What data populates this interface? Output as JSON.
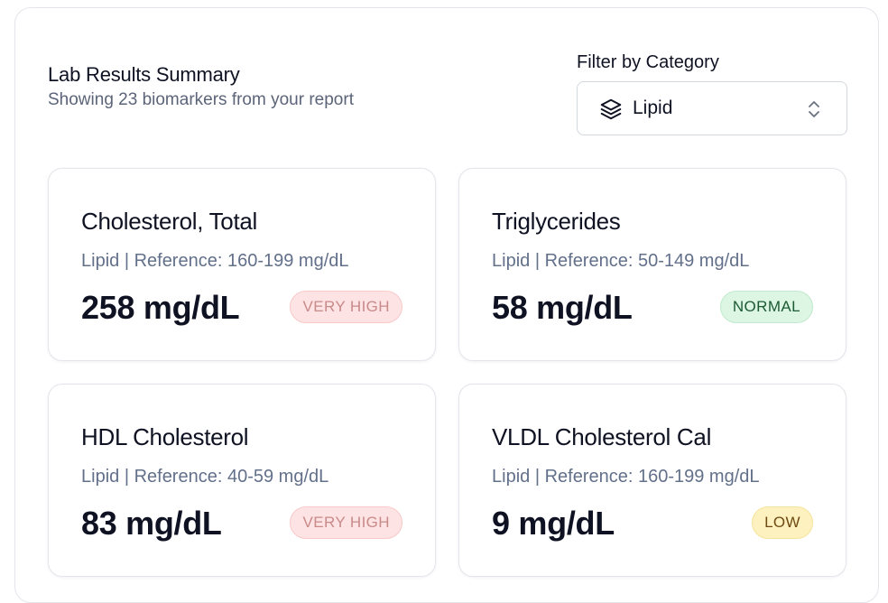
{
  "header": {
    "title": "Lab Results Summary",
    "subtitle": "Showing 23 biomarkers from your report"
  },
  "filter": {
    "label": "Filter by Category",
    "selected": "Lipid",
    "icon": "layers-icon",
    "chevron_icon": "chevron-up-down-icon"
  },
  "cards": [
    {
      "name": "Cholesterol, Total",
      "reference": "Lipid | Reference: 160-199 mg/dL",
      "value": "258 mg/dL",
      "status": "VERY HIGH",
      "status_colors": {
        "bg": "#fde3e3",
        "border": "#f8c9c9",
        "text": "#c98a8a"
      }
    },
    {
      "name": "Triglycerides",
      "reference": "Lipid | Reference: 50-149 mg/dL",
      "value": "58 mg/dL",
      "status": "NORMAL",
      "status_colors": {
        "bg": "#dcf6e3",
        "border": "#bfeacd",
        "text": "#1d5a33"
      }
    },
    {
      "name": "HDL Cholesterol",
      "reference": "Lipid | Reference: 40-59 mg/dL",
      "value": "83 mg/dL",
      "status": "VERY HIGH",
      "status_colors": {
        "bg": "#fde3e3",
        "border": "#f8c9c9",
        "text": "#c98a8a"
      }
    },
    {
      "name": "VLDL Cholesterol Cal",
      "reference": "Lipid | Reference: 160-199 mg/dL",
      "value": "9 mg/dL",
      "status": "LOW",
      "status_colors": {
        "bg": "#fdf1bf",
        "border": "#f5e39a",
        "text": "#6e4a12"
      }
    }
  ]
}
